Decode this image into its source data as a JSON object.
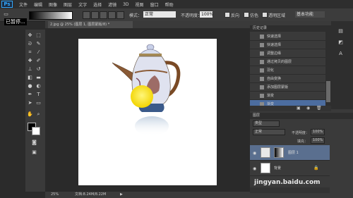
{
  "app": {
    "logo": "Ps"
  },
  "menu": [
    "文件",
    "编辑",
    "图像",
    "图层",
    "文字",
    "选择",
    "滤镜",
    "3D",
    "视图",
    "窗口",
    "帮助"
  ],
  "options": {
    "mode_label": "模式：",
    "mode_value": "正常",
    "opacity_label": "不透明度：",
    "opacity_value": "100%",
    "reverse": "反向",
    "dither": "仿色",
    "transparency": "透明区域",
    "workspace": "基本功能"
  },
  "overlay": {
    "paused": "已暂停..."
  },
  "document": {
    "tab": "2.jpg @ 25% (图层 1, 图层蒙版/8) *"
  },
  "status": {
    "zoom": "25%",
    "doc": "文档:8.24M/8.22M"
  },
  "history": {
    "title": "历史记录",
    "items": [
      "快速选择",
      "快速选择",
      "调整边缘",
      "通过拷贝的图层",
      "羽化",
      "自由变换",
      "添加图层蒙版",
      "渐变",
      "渐变"
    ],
    "selected_index": 8
  },
  "layers": {
    "title": "图层",
    "filter": "类型",
    "blend": "正常",
    "opacity_label": "不透明度：",
    "opacity_value": "100%",
    "fill_label": "填充：",
    "fill_value": "100%",
    "rows": [
      {
        "name": "图层 1",
        "selected": true
      },
      {
        "name": "背景",
        "selected": false
      }
    ]
  },
  "watermark": "jingyan.baidu.com",
  "colors": {
    "accent": "#31a8ff",
    "selection": "#4c6da0"
  }
}
